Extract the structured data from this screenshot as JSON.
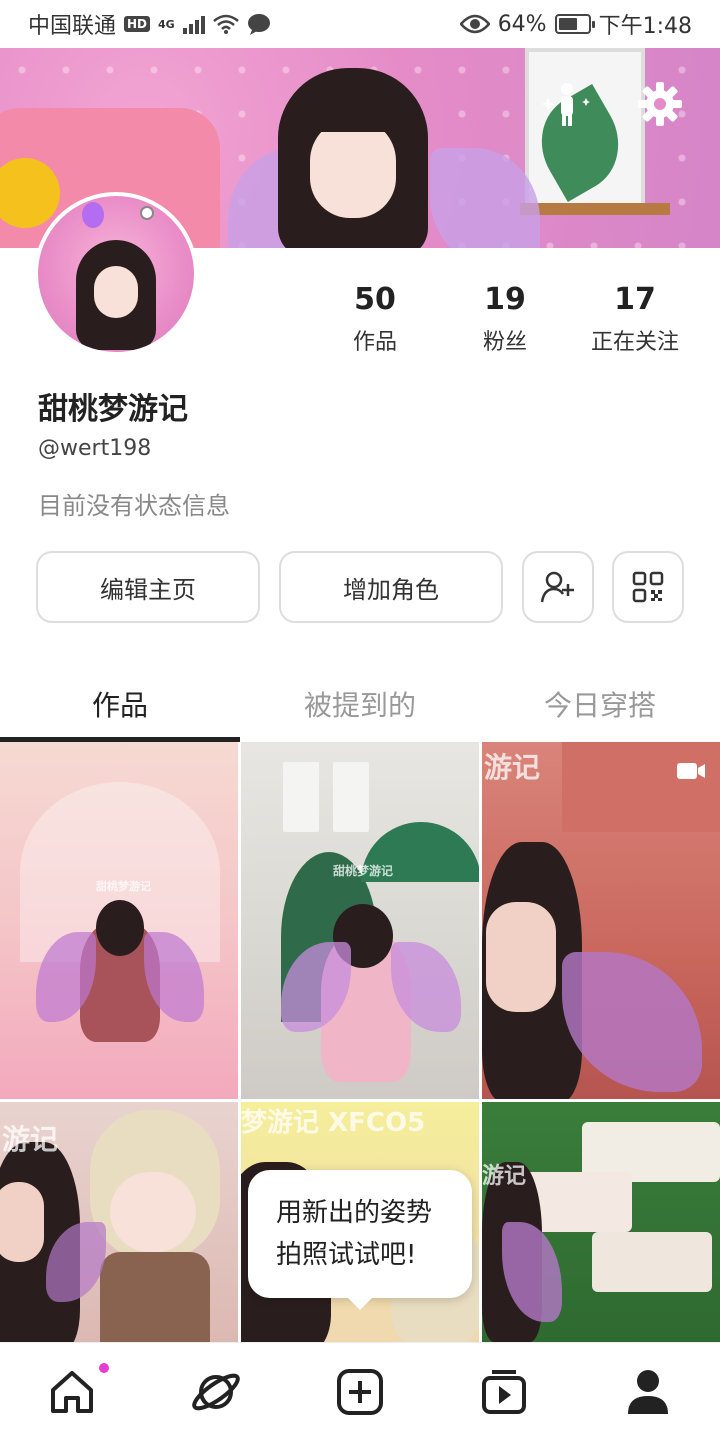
{
  "status_bar": {
    "carrier": "中国联通",
    "hd": "HD",
    "network": "4G",
    "battery": "64%",
    "battery_level": 0.64,
    "time": "下午1:48"
  },
  "banner": {
    "avatar_icon": "avatar-pose-icon",
    "settings_icon": "gear-icon"
  },
  "profile": {
    "name": "甜桃梦游记",
    "handle": "@wert198",
    "status": "目前没有状态信息",
    "stats": [
      {
        "value": "50",
        "label": "作品"
      },
      {
        "value": "19",
        "label": "粉丝"
      },
      {
        "value": "17",
        "label": "正在关注"
      }
    ]
  },
  "actions": {
    "edit": "编辑主页",
    "add_role": "增加角色",
    "add_friend_icon": "add-friend-icon",
    "qr_icon": "qr-code-icon"
  },
  "tabs": [
    "作品",
    "被提到的",
    "今日穿搭"
  ],
  "active_tab": 0,
  "grid": {
    "watermark_name": "甜桃梦游记",
    "watermark_short": "游记",
    "watermark_code": "梦游记 XFCO5",
    "video_icon": "video-camera-icon"
  },
  "tooltip": {
    "line1": "用新出的姿势",
    "line2": "拍照试试吧!"
  },
  "bottom_nav": [
    {
      "icon": "home-icon",
      "badge": true
    },
    {
      "icon": "planet-icon"
    },
    {
      "icon": "add-post-icon"
    },
    {
      "icon": "play-feed-icon"
    },
    {
      "icon": "profile-icon"
    }
  ],
  "colors": {
    "banner": "#e58cc8",
    "badge": "#e83bd0",
    "text": "#222222",
    "muted": "#999999"
  }
}
